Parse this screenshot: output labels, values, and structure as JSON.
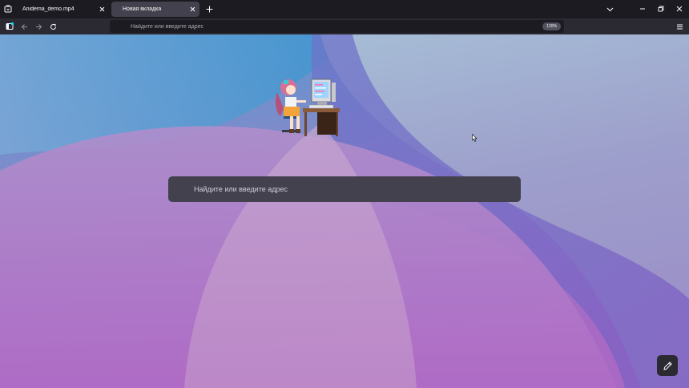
{
  "tabs": [
    {
      "title": "Anidema_demo.mp4",
      "active": false
    },
    {
      "title": "Новая вкладка",
      "active": true
    }
  ],
  "navbar": {
    "url_placeholder": "Найдите или введите адрес",
    "zoom": "120%"
  },
  "content": {
    "search_placeholder": "Найдите или введите адрес"
  },
  "icons": {
    "tab_list": "tab-list-icon",
    "tab_close": "close-icon",
    "new_tab": "plus-icon",
    "menu": "hamburger-menu-icon",
    "edit": "pencil-icon"
  },
  "colors": {
    "chrome_dark": "#1c1b22",
    "toolbar": "#2b2a33",
    "tab_active": "#42414d",
    "text": "#fbfbfe",
    "accent": "#00ddff"
  }
}
